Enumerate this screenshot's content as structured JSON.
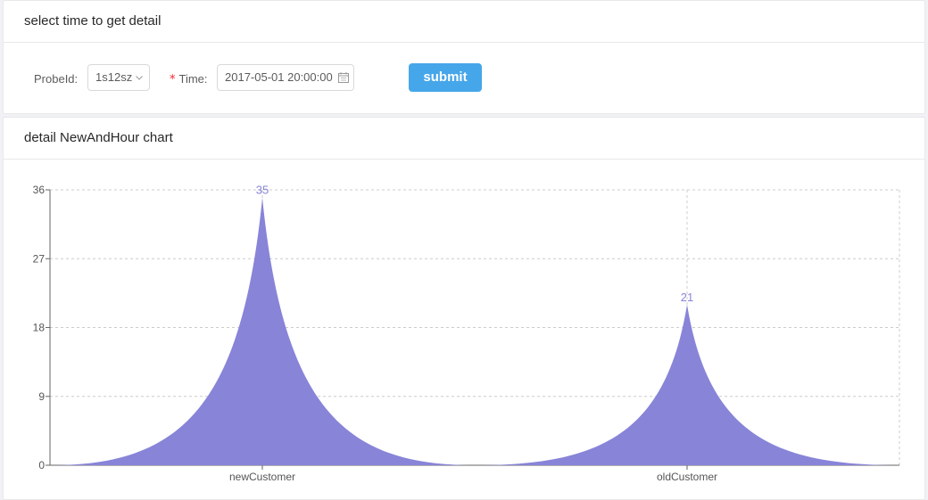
{
  "filter_card": {
    "title": "select time to get detail",
    "probe_label": "ProbeId",
    "probe_colon": ":",
    "probe_value": "1s12sz",
    "time_label": "Time",
    "time_colon": ":",
    "required_mark": "*",
    "time_value": "2017-05-01 20:00:00",
    "submit_label": "submit",
    "icons": {
      "select": "chevron-down-icon",
      "date": "calendar-icon"
    }
  },
  "chart_card": {
    "title": "detail NewAndHour chart"
  },
  "colors": {
    "series": "#8884d8",
    "button": "#46a6ea",
    "required": "#f5222d"
  },
  "chart_data": {
    "type": "bar",
    "categories": [
      "newCustomer",
      "oldCustomer"
    ],
    "values": [
      35,
      21
    ],
    "yticks": [
      0,
      9,
      18,
      27,
      36
    ],
    "ylim": [
      0,
      36
    ],
    "grid": true,
    "data_labels": true,
    "title": "",
    "xlabel": "",
    "ylabel": ""
  }
}
